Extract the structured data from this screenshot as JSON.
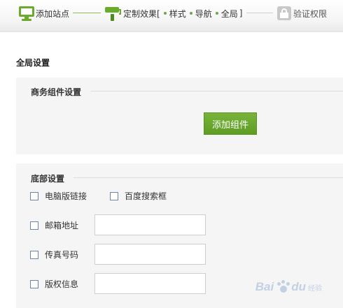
{
  "wizard": {
    "step1_label": "添加站点",
    "step2_label": "定制效果[",
    "step2_sub1": "样式",
    "step2_sub2": "导航",
    "step2_sub3": "全局",
    "step2_close": "]",
    "step3_label": "验证权限",
    "icons": [
      "monitor-icon",
      "paint-roller-icon",
      "lock-icon"
    ],
    "accent_color": "#6aaa2c"
  },
  "main": {
    "section_title": "全局设置",
    "component_panel": {
      "heading": "商务组件设置",
      "add_button_label": "添加组件"
    },
    "footer_panel": {
      "heading": "底部设置",
      "checkboxes": [
        {
          "label": "电脑版链接",
          "checked": false
        },
        {
          "label": "百度搜索框",
          "checked": false
        }
      ],
      "fields": [
        {
          "label": "邮箱地址",
          "checked": false,
          "value": ""
        },
        {
          "label": "传真号码",
          "checked": false,
          "value": ""
        },
        {
          "label": "版权信息",
          "checked": false,
          "value": ""
        }
      ]
    }
  },
  "watermark": {
    "text": "Bai",
    "text2": "du",
    "sub": "经验"
  }
}
